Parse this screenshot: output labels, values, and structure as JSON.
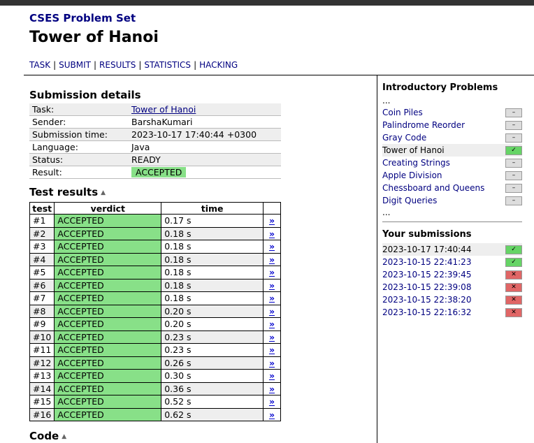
{
  "site_title": "CSES Problem Set",
  "page_title": "Tower of Hanoi",
  "nav": [
    "TASK",
    "SUBMIT",
    "RESULTS",
    "STATISTICS",
    "HACKING"
  ],
  "submission": {
    "heading": "Submission details",
    "rows": [
      {
        "label": "Task:",
        "value": "Tower of Hanoi",
        "type": "link"
      },
      {
        "label": "Sender:",
        "value": "BarshaKumari",
        "type": "text"
      },
      {
        "label": "Submission time:",
        "value": "2023-10-17 17:40:44 +0300",
        "type": "text"
      },
      {
        "label": "Language:",
        "value": "Java",
        "type": "text"
      },
      {
        "label": "Status:",
        "value": "READY",
        "type": "text"
      },
      {
        "label": "Result:",
        "value": "ACCEPTED",
        "type": "badge"
      }
    ]
  },
  "tests": {
    "heading": "Test results",
    "columns": [
      "test",
      "verdict",
      "time"
    ],
    "link_glyph": "»",
    "rows": [
      {
        "test": "#1",
        "verdict": "ACCEPTED",
        "time": "0.17 s"
      },
      {
        "test": "#2",
        "verdict": "ACCEPTED",
        "time": "0.18 s"
      },
      {
        "test": "#3",
        "verdict": "ACCEPTED",
        "time": "0.18 s"
      },
      {
        "test": "#4",
        "verdict": "ACCEPTED",
        "time": "0.18 s"
      },
      {
        "test": "#5",
        "verdict": "ACCEPTED",
        "time": "0.18 s"
      },
      {
        "test": "#6",
        "verdict": "ACCEPTED",
        "time": "0.18 s"
      },
      {
        "test": "#7",
        "verdict": "ACCEPTED",
        "time": "0.18 s"
      },
      {
        "test": "#8",
        "verdict": "ACCEPTED",
        "time": "0.20 s"
      },
      {
        "test": "#9",
        "verdict": "ACCEPTED",
        "time": "0.20 s"
      },
      {
        "test": "#10",
        "verdict": "ACCEPTED",
        "time": "0.23 s"
      },
      {
        "test": "#11",
        "verdict": "ACCEPTED",
        "time": "0.23 s"
      },
      {
        "test": "#12",
        "verdict": "ACCEPTED",
        "time": "0.26 s"
      },
      {
        "test": "#13",
        "verdict": "ACCEPTED",
        "time": "0.30 s"
      },
      {
        "test": "#14",
        "verdict": "ACCEPTED",
        "time": "0.36 s"
      },
      {
        "test": "#15",
        "verdict": "ACCEPTED",
        "time": "0.52 s"
      },
      {
        "test": "#16",
        "verdict": "ACCEPTED",
        "time": "0.62 s"
      }
    ]
  },
  "code_heading": "Code",
  "sidebar": {
    "problems_heading": "Introductory Problems",
    "ellipsis": "...",
    "problems": [
      {
        "name": "Coin Piles",
        "status": "none",
        "current": false
      },
      {
        "name": "Palindrome Reorder",
        "status": "none",
        "current": false
      },
      {
        "name": "Gray Code",
        "status": "none",
        "current": false
      },
      {
        "name": "Tower of Hanoi",
        "status": "ok",
        "current": true
      },
      {
        "name": "Creating Strings",
        "status": "none",
        "current": false
      },
      {
        "name": "Apple Division",
        "status": "none",
        "current": false
      },
      {
        "name": "Chessboard and Queens",
        "status": "none",
        "current": false
      },
      {
        "name": "Digit Queries",
        "status": "none",
        "current": false
      }
    ],
    "submissions_heading": "Your submissions",
    "submissions": [
      {
        "time": "2023-10-17 17:40:44",
        "status": "ok",
        "current": true
      },
      {
        "time": "2023-10-15 22:41:23",
        "status": "ok",
        "current": false
      },
      {
        "time": "2023-10-15 22:39:45",
        "status": "bad",
        "current": false
      },
      {
        "time": "2023-10-15 22:39:08",
        "status": "bad",
        "current": false
      },
      {
        "time": "2023-10-15 22:38:20",
        "status": "bad",
        "current": false
      },
      {
        "time": "2023-10-15 22:16:32",
        "status": "bad",
        "current": false
      }
    ],
    "status_glyphs": {
      "none": "–",
      "ok": "✓",
      "bad": "✕"
    },
    "status_colors": {
      "none": "#dddddd",
      "ok": "#66d466",
      "bad": "#e06666"
    }
  }
}
